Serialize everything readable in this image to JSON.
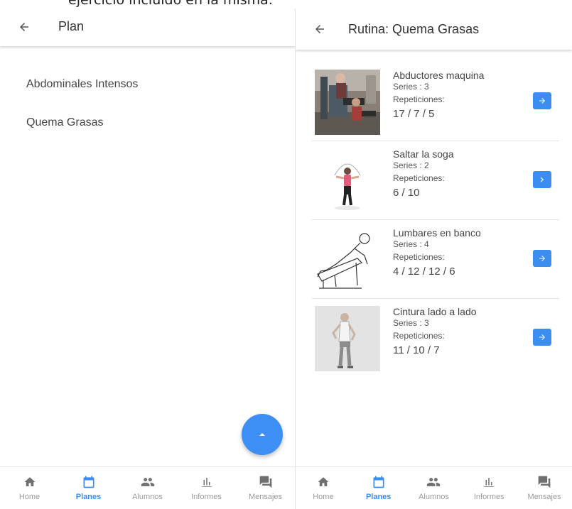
{
  "caption": "ejercicio incluido en la misma.",
  "colors": {
    "accent": "#3b8ef0",
    "icon_gray": "#6f6f6f",
    "label_gray": "#9a9a9a"
  },
  "left_panel": {
    "back_icon": "arrow-left-icon",
    "title": "Plan",
    "plans": [
      "Abdominales Intensos",
      "Quema Grasas"
    ],
    "fab_icon": "chevron-up-icon"
  },
  "right_panel": {
    "back_icon": "arrow-left-icon",
    "title": "Rutina: Quema Grasas",
    "exercises": [
      {
        "name": "Abductores maquina",
        "series": "Series : 3",
        "rep_label": "Repeticiones:",
        "reps": "17 / 7 / 5",
        "thumb": "gym-machine-photo"
      },
      {
        "name": "Saltar la soga",
        "series": "Series : 2",
        "rep_label": "Repeticiones:",
        "reps": "6 / 10",
        "thumb": "jump-rope-photo"
      },
      {
        "name": "Lumbares en banco",
        "series": "Series : 4",
        "rep_label": "Repeticiones:",
        "reps": "4 / 12 / 12 / 6",
        "thumb": "bench-sketch"
      },
      {
        "name": "Cintura lado a lado",
        "series": "Series : 3",
        "rep_label": "Repeticiones:",
        "reps": "11 / 10 / 7",
        "thumb": "waist-twist-photo"
      }
    ],
    "go_icon": "arrow-right-icon"
  },
  "bottom_nav": {
    "items": [
      {
        "label": "Home",
        "icon": "home-icon",
        "active": false
      },
      {
        "label": "Planes",
        "icon": "calendar-icon",
        "active": true
      },
      {
        "label": "Alumnos",
        "icon": "people-icon",
        "active": false
      },
      {
        "label": "Informes",
        "icon": "bar-chart-icon",
        "active": false
      },
      {
        "label": "Mensajes",
        "icon": "chat-icon",
        "active": false
      }
    ]
  }
}
